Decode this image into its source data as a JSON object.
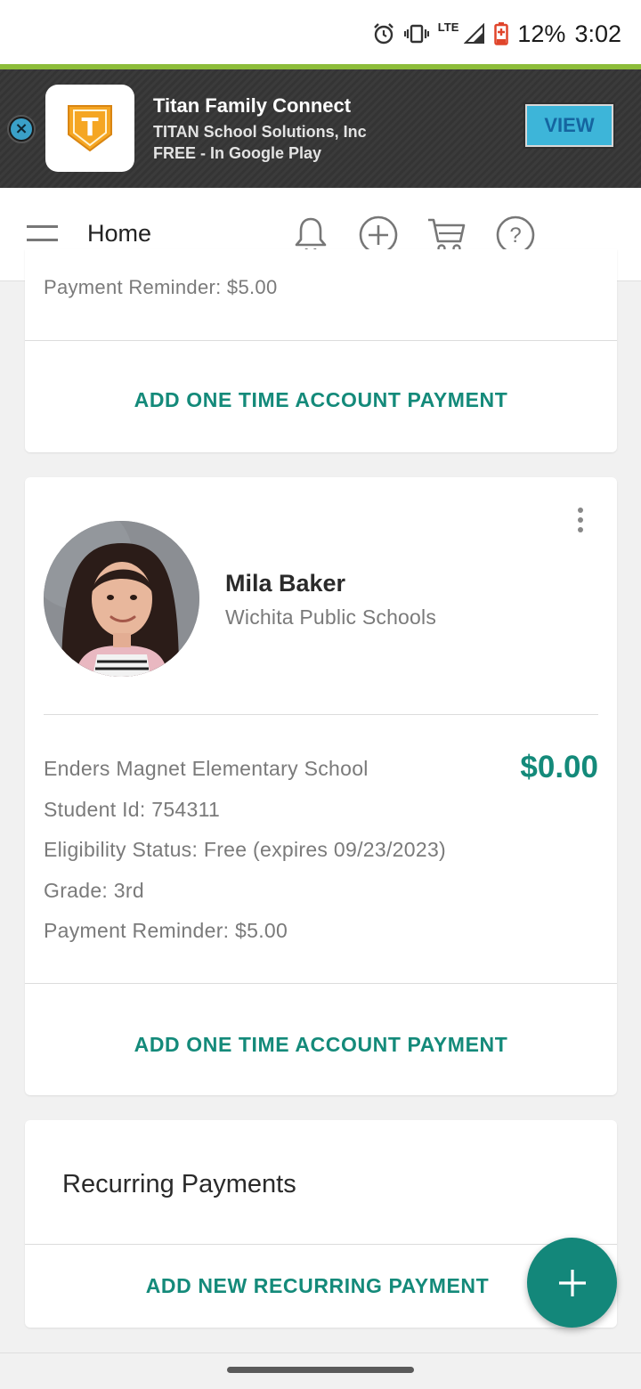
{
  "status_bar": {
    "battery": "12%",
    "time": "3:02",
    "network": "LTE",
    "icons": [
      "alarm-icon",
      "vibrate-icon",
      "signal-icon",
      "battery-icon"
    ]
  },
  "ad": {
    "app_name": "Titan Family Connect",
    "publisher": "TITAN School Solutions, Inc",
    "price_store": "FREE - In Google Play",
    "cta": "VIEW",
    "logo_letter": "T"
  },
  "header": {
    "title": "Home",
    "icons": [
      "bell-icon",
      "add-circle-icon",
      "cart-icon",
      "help-icon"
    ]
  },
  "previous_card": {
    "reminder": "Payment Reminder: $5.00",
    "action": "ADD ONE TIME ACCOUNT PAYMENT"
  },
  "student": {
    "name": "Mila Baker",
    "district": "Wichita Public Schools",
    "school": "Enders Magnet Elementary School",
    "balance": "$0.00",
    "student_id": "Student Id: 754311",
    "eligibility": "Eligibility Status: Free (expires 09/23/2023)",
    "grade": "Grade: 3rd",
    "reminder": "Payment Reminder: $5.00",
    "action": "ADD ONE TIME ACCOUNT PAYMENT"
  },
  "recurring": {
    "title": "Recurring Payments",
    "action": "ADD NEW RECURRING PAYMENT"
  },
  "colors": {
    "accent": "#148a7a",
    "fab": "#13877a",
    "ad_bar": "#8dbd3a"
  }
}
